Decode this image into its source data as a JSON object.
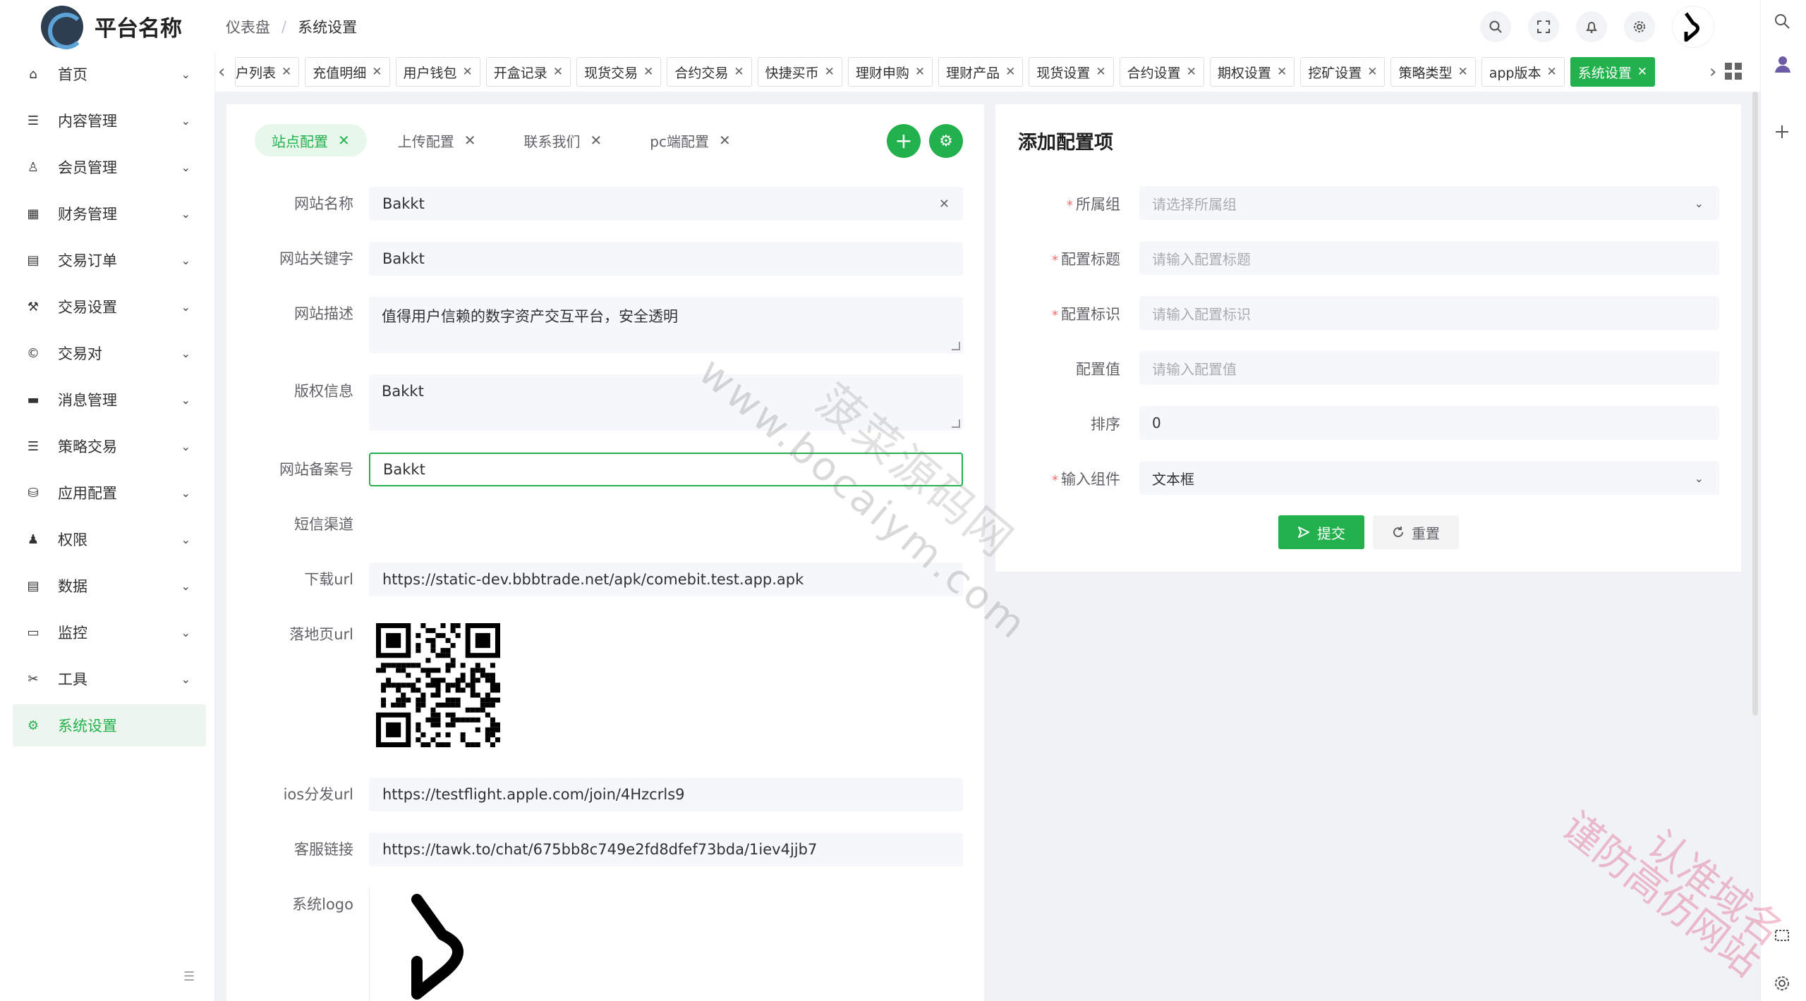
{
  "app": {
    "title": "平台名称",
    "breadcrumb": [
      "仪表盘",
      "系统设置"
    ],
    "breadcrumb_sep": "/"
  },
  "colors": {
    "accent": "#22b14c",
    "required": "#f56c6c"
  },
  "header_icons": [
    "search-icon",
    "fullscreen-icon",
    "bell-icon",
    "gear-icon"
  ],
  "sidebar": {
    "items": [
      {
        "label": "首页",
        "icon": "home-icon",
        "glyph": "⌂"
      },
      {
        "label": "内容管理",
        "icon": "list-icon",
        "glyph": "☰"
      },
      {
        "label": "会员管理",
        "icon": "user-icon",
        "glyph": "♙"
      },
      {
        "label": "财务管理",
        "icon": "grid-icon",
        "glyph": "▦"
      },
      {
        "label": "交易订单",
        "icon": "table-icon",
        "glyph": "▤"
      },
      {
        "label": "交易设置",
        "icon": "wrench-icon",
        "glyph": "⚒"
      },
      {
        "label": "交易对",
        "icon": "copyright-icon",
        "glyph": "©"
      },
      {
        "label": "消息管理",
        "icon": "message-icon",
        "glyph": "▬"
      },
      {
        "label": "策略交易",
        "icon": "menu-icon",
        "glyph": "☰"
      },
      {
        "label": "应用配置",
        "icon": "coins-icon",
        "glyph": "⛁"
      },
      {
        "label": "权限",
        "icon": "user-key-icon",
        "glyph": "♟"
      },
      {
        "label": "数据",
        "icon": "database-icon",
        "glyph": "▤"
      },
      {
        "label": "监控",
        "icon": "monitor-icon",
        "glyph": "▭"
      },
      {
        "label": "工具",
        "icon": "tools-icon",
        "glyph": "✂"
      },
      {
        "label": "系统设置",
        "icon": "gear-icon",
        "glyph": "⚙",
        "active": true
      }
    ]
  },
  "tabs": [
    {
      "label": "户列表"
    },
    {
      "label": "充值明细"
    },
    {
      "label": "用户钱包"
    },
    {
      "label": "开盒记录"
    },
    {
      "label": "现货交易"
    },
    {
      "label": "合约交易"
    },
    {
      "label": "快捷买币"
    },
    {
      "label": "理财申购"
    },
    {
      "label": "理财产品"
    },
    {
      "label": "现货设置"
    },
    {
      "label": "合约设置"
    },
    {
      "label": "期权设置"
    },
    {
      "label": "挖矿设置"
    },
    {
      "label": "策略类型"
    },
    {
      "label": "app版本"
    },
    {
      "label": "系统设置",
      "active": true
    }
  ],
  "tab_close": "✕",
  "config_tabs": [
    {
      "label": "站点配置",
      "active": true
    },
    {
      "label": "上传配置"
    },
    {
      "label": "联系我们"
    },
    {
      "label": "pc端配置"
    }
  ],
  "site_form": {
    "name_label": "网站名称",
    "name_value": "Bakkt",
    "keywords_label": "网站关键字",
    "keywords_value": "Bakkt",
    "desc_label": "网站描述",
    "desc_value": "值得用户信赖的数字资产交互平台，安全透明",
    "copyright_label": "版权信息",
    "copyright_value": "Bakkt",
    "icp_label": "网站备案号",
    "icp_value": "Bakkt",
    "sms_label": "短信渠道",
    "download_label": "下载url",
    "download_value": "https://static-dev.bbbtrade.net/apk/comebit.test.app.apk",
    "landing_label": "落地页url",
    "ios_label": "ios分发url",
    "ios_value": "https://testflight.apple.com/join/4Hzcrls9",
    "service_label": "客服链接",
    "service_value": "https://tawk.to/chat/675bb8c749e2fd8dfef73bda/1iev4jjb7",
    "logo_label": "系统logo"
  },
  "add_form": {
    "title": "添加配置项",
    "group_label": "所属组",
    "group_placeholder": "请选择所属组",
    "title_label": "配置标题",
    "title_placeholder": "请输入配置标题",
    "key_label": "配置标识",
    "key_placeholder": "请输入配置标识",
    "value_label": "配置值",
    "value_placeholder": "请输入配置值",
    "sort_label": "排序",
    "sort_value": "0",
    "component_label": "输入组件",
    "component_value": "文本框",
    "submit_label": "提交",
    "reset_label": "重置"
  },
  "watermarks": {
    "site": "www.bocaiym.com",
    "cn": "菠菜源码网",
    "corner1": "认准域名",
    "corner2": "谨防高仿网站"
  }
}
